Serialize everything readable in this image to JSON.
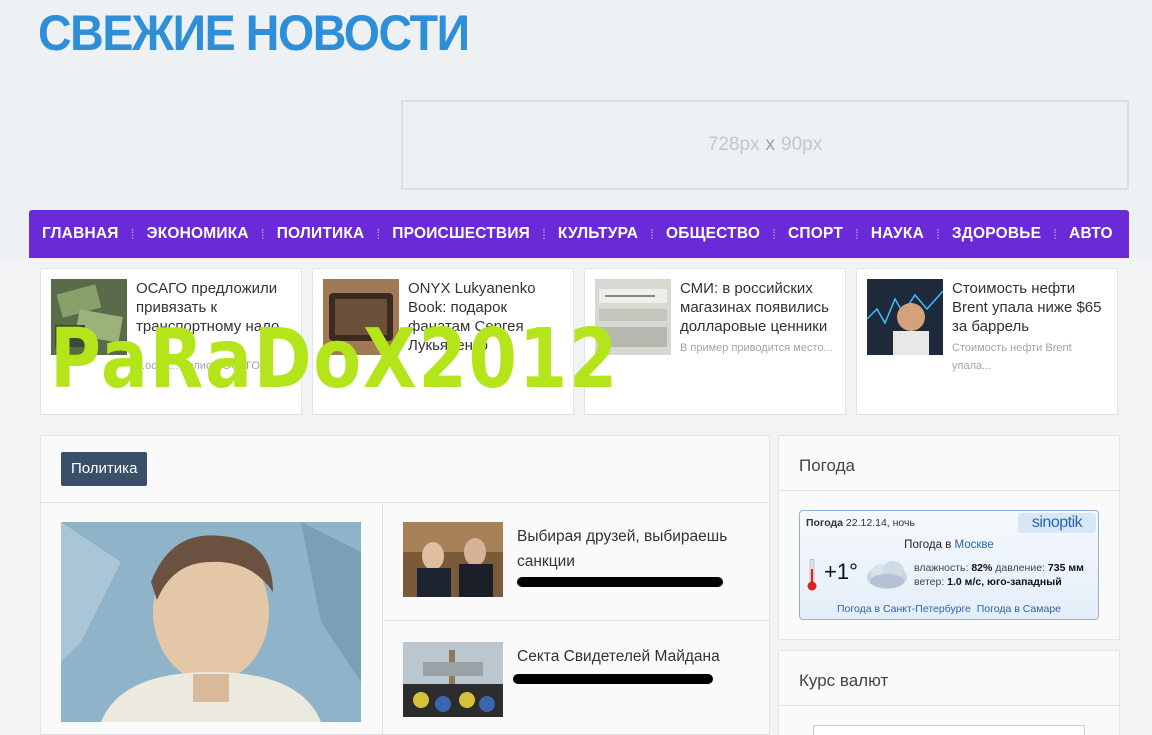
{
  "site": {
    "title": "СВЕЖИЕ НОВОСТИ"
  },
  "ad": {
    "width_text": "728px",
    "times": "x",
    "height_text": "90px"
  },
  "nav": [
    "ГЛАВНАЯ",
    "ЭКОНОМИКА",
    "ПОЛИТИКА",
    "ПРОИСШЕСТВИЯ",
    "КУЛЬТУРА",
    "ОБЩЕСТВО",
    "СПОРТ",
    "НАУКА",
    "ЗДОРОВЬЕ",
    "АВТО"
  ],
  "news": [
    {
      "title": "ОСАГО предложили привязать к транспортному нало...",
      "excerpt": "...особ... полисы ОСАГО"
    },
    {
      "title": "ONYX Lukyanenko Book: подарок фанатам Сергея Лукьяненко",
      "excerpt": ""
    },
    {
      "title": "СМИ: в российских магазинах появились долларовые ценники",
      "excerpt": "В пример приводится место..."
    },
    {
      "title": "Стоимость нефти Brent упала ниже $65 за баррель",
      "excerpt": "Стоимость нефти Brent упала..."
    }
  ],
  "politics": {
    "tag": "Политика",
    "items": [
      {
        "title": "Выбирая друзей, выбираешь санкции"
      },
      {
        "title": "Секта Свидетелей Майдана"
      }
    ]
  },
  "weather_widget": {
    "title": "Погода",
    "head_label": "Погода",
    "head_date": "22.12.14, ночь",
    "brand": "sinoptik",
    "city_prefix": "Погода в",
    "city": "Москве",
    "temp": "+1°",
    "humidity_label": "влажность:",
    "humidity": "82%",
    "pressure_label": "давление:",
    "pressure": "735 мм",
    "wind_label": "ветер:",
    "wind": "1.0 м/с, юго-западный",
    "link1": "Погода в Санкт-Петербурге",
    "link2": "Погода в Самаре"
  },
  "currency_widget": {
    "title": "Курс валют"
  },
  "watermark": "PaRaDoX2012",
  "colors": {
    "brand_blue": "#2e8fd8",
    "nav_purple": "#6a2ad8",
    "tag_bg": "#3a5068",
    "watermark": "#b4e51a"
  }
}
